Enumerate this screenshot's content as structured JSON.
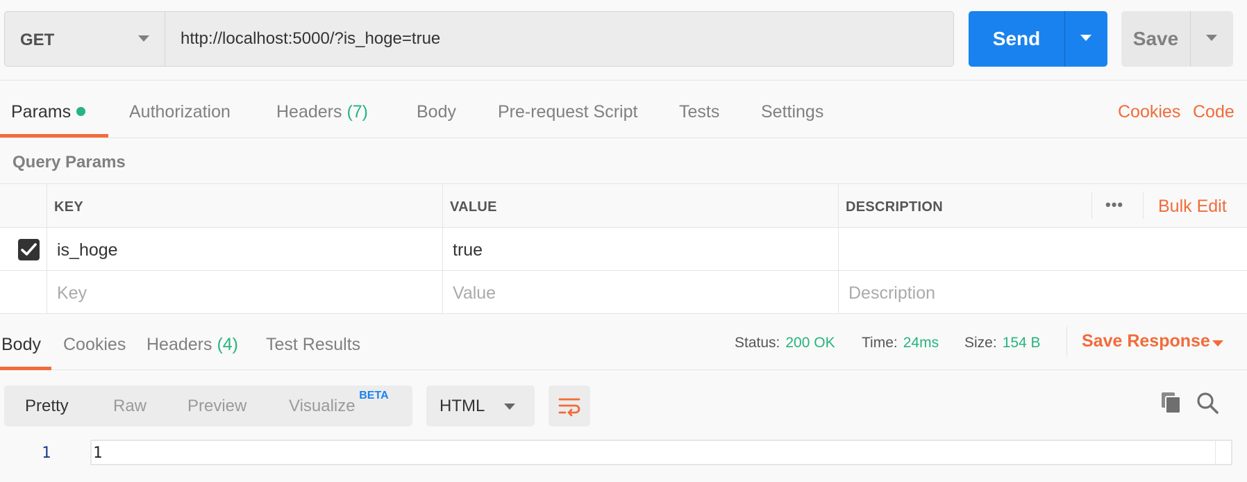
{
  "request": {
    "method": "GET",
    "url": "http://localhost:5000/?is_hoge=true",
    "send_label": "Send",
    "save_label": "Save"
  },
  "request_tabs": {
    "params": "Params",
    "authorization": "Authorization",
    "headers": "Headers",
    "headers_count": "(7)",
    "body": "Body",
    "prerequest": "Pre-request Script",
    "tests": "Tests",
    "settings": "Settings",
    "cookies": "Cookies",
    "code": "Code"
  },
  "query_params": {
    "title": "Query Params",
    "columns": {
      "key": "KEY",
      "value": "VALUE",
      "description": "DESCRIPTION"
    },
    "bulk_edit": "Bulk Edit",
    "more": "•••",
    "rows": [
      {
        "checked": true,
        "key": "is_hoge",
        "value": "true",
        "description": ""
      }
    ],
    "placeholders": {
      "key": "Key",
      "value": "Value",
      "description": "Description"
    }
  },
  "response_tabs": {
    "body": "Body",
    "cookies": "Cookies",
    "headers": "Headers",
    "headers_count": "(4)",
    "test_results": "Test Results"
  },
  "response_status": {
    "status_label": "Status:",
    "status_value": "200 OK",
    "time_label": "Time:",
    "time_value": "24ms",
    "size_label": "Size:",
    "size_value": "154 B",
    "save_response": "Save Response"
  },
  "response_view": {
    "modes": [
      "Pretty",
      "Raw",
      "Preview",
      "Visualize"
    ],
    "beta": "BETA",
    "format": "HTML",
    "lines": [
      {
        "number": "1",
        "text": "1"
      }
    ]
  },
  "colors": {
    "accent": "#f26b3a",
    "primary": "#1a82ee",
    "success": "#26b47f"
  },
  "icons": [
    "chevron-down-icon",
    "checkmark-icon",
    "wrap-lines-icon",
    "copy-icon",
    "search-icon",
    "more-icon"
  ]
}
